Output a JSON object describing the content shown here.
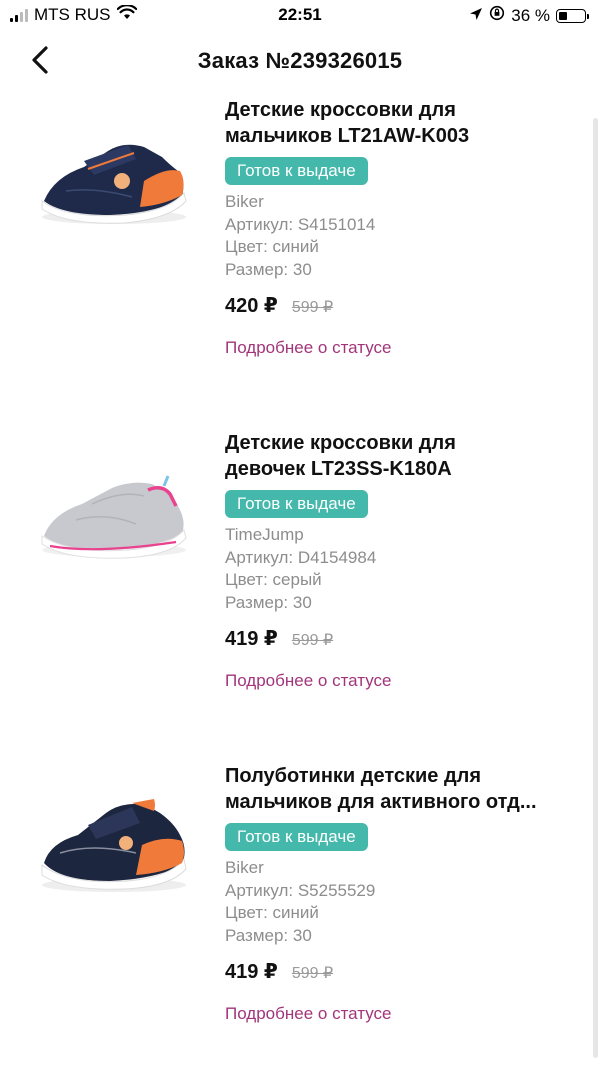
{
  "status_bar": {
    "carrier": "MTS RUS",
    "time": "22:51",
    "battery": "36 %",
    "battery_level": 0.36,
    "icons": [
      "signal-icon",
      "wifi-icon",
      "location-arrow-icon",
      "screen-lock-rotation-icon",
      "battery-icon"
    ]
  },
  "header": {
    "title": "Заказ №239326015",
    "back_icon": "chevron-left-icon"
  },
  "items": [
    {
      "name": "Детские кроссовки для мальчиков LT21AW-K003",
      "name_line1": "Детские кроссовки для",
      "name_line2": "мальчиков LT21AW-K003",
      "status": "Готов к выдаче",
      "brand": "Biker",
      "article": "Артикул:  S4151014",
      "color": "Цвет:  синий",
      "size": "Размер:  30",
      "price": "420 ₽",
      "old_price": "599 ₽",
      "link": "Подробнее о статусе",
      "image": "navy-orange-sneaker"
    },
    {
      "name": "Детские кроссовки для девочек LT23SS-K180A",
      "name_line1": "Детские кроссовки для",
      "name_line2": "девочек LT23SS-K180A",
      "status": "Готов к выдаче",
      "brand": "TimeJump",
      "article": "Артикул:  D4154984",
      "color": "Цвет:  серый",
      "size": "Размер:  30",
      "price": "419 ₽",
      "old_price": "599 ₽",
      "link": "Подробнее о статусе",
      "image": "grey-pink-sneaker"
    },
    {
      "name": "Полуботинки детские для мальчиков для активного отд...",
      "name_line1": "Полуботинки детские для",
      "name_line2": "мальчиков для активного отд...",
      "status": "Готов к выдаче",
      "brand": "Biker",
      "article": "Артикул:  S5255529",
      "color": "Цвет:  синий",
      "size": "Размер:  30",
      "price": "419 ₽",
      "old_price": "599 ₽",
      "link": "Подробнее о статусе",
      "image": "navy-orange-sneaker-2"
    }
  ],
  "colors": {
    "badge": "#45b8ac",
    "link": "#a2357a",
    "muted": "#8d8d8d"
  }
}
